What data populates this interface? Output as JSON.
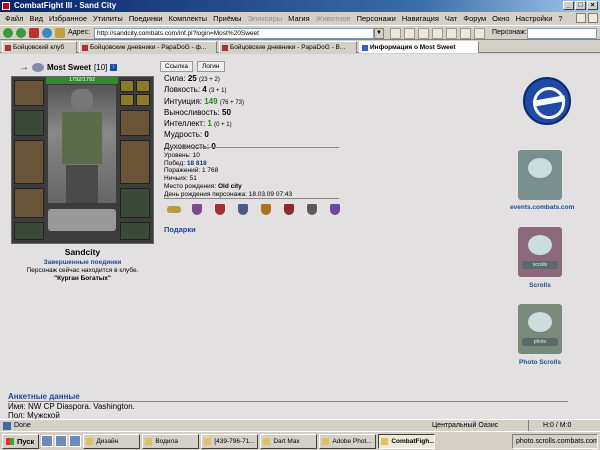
{
  "window": {
    "title": "CombatFight III - Sand City",
    "controls": [
      "_",
      "□",
      "×"
    ]
  },
  "menu": [
    "Файл",
    "Вид",
    "Избранное",
    "Утилиты",
    "Поединки",
    "Комплекты",
    "Приёмы",
    "Эликсиры",
    "Магия",
    "Животное",
    "Персонажи",
    "Навигация",
    "Чат",
    "Форум",
    "Окно",
    "Настройки",
    "?"
  ],
  "menu_disabled": [
    "Эликсиры",
    "Животное"
  ],
  "address": {
    "label": "Адрес:",
    "value": "http://sandcity.combats.com/inf.pl?login=Most%20Sweet",
    "dropdown": "▼"
  },
  "persona_label": "Персонаж:",
  "tabs": [
    {
      "label": "Бойцовский клуб"
    },
    {
      "label": "Бойцовские дневники - PapaDoG - ф..."
    },
    {
      "label": "Бойцовские дневники - PapaDoG - B..."
    },
    {
      "label": "Информация о Most Sweet"
    }
  ],
  "character": {
    "name": "Most Sweet",
    "level": "[10]",
    "info_icon": "i",
    "hp": "1792/1792",
    "display_name": "Sandcity",
    "fights_link": "Завершенные поединки",
    "location_text": "Персонаж сейчас находится в клубе.",
    "club": "\"Курган Богатых\""
  },
  "subtabs": [
    "Ссылка",
    "Логин"
  ],
  "stats": [
    {
      "label": "Сила:",
      "value": "25",
      "sub": "(23 + 2)",
      "green": false
    },
    {
      "label": "Ловкость:",
      "value": "4",
      "sub": "(3 + 1)",
      "green": false
    },
    {
      "label": "Интуиция:",
      "value": "149",
      "sub": "(76 + 73)",
      "green": true
    },
    {
      "label": "Выносливость:",
      "value": "50",
      "sub": "",
      "green": false
    },
    {
      "label": "Интеллект:",
      "value": "1",
      "sub": "(0 + 1)",
      "green": true
    },
    {
      "label": "Мудрость:",
      "value": "0",
      "sub": "",
      "green": false
    },
    {
      "label": "Духовность:",
      "value": "0",
      "sub": "",
      "green": false
    }
  ],
  "info": [
    {
      "label": "Уровень:",
      "value": "10",
      "style": "plain"
    },
    {
      "label": "Побед:",
      "value": "18 818",
      "style": "blue"
    },
    {
      "label": "Поражений:",
      "value": "1 768",
      "style": "plain"
    },
    {
      "label": "Ничьих:",
      "value": "51",
      "style": "plain"
    },
    {
      "label": "Место рождения:",
      "value": "Old city",
      "style": "black"
    },
    {
      "label": "День рождения персонажа:",
      "value": "18.03.09 07:43",
      "style": "plain"
    }
  ],
  "badges": [
    {
      "name": "scroll-badge",
      "color": "#b89a40"
    },
    {
      "name": "shield-badge-1",
      "color": "#7a4a8a"
    },
    {
      "name": "shield-badge-2",
      "color": "#a03030"
    },
    {
      "name": "shield-badge-3",
      "color": "#4a5a8a"
    },
    {
      "name": "shield-badge-4",
      "color": "#b07020"
    },
    {
      "name": "shield-badge-5",
      "color": "#8a2a2a"
    },
    {
      "name": "shield-badge-6",
      "color": "#5a5a5a"
    },
    {
      "name": "shield-badge-7",
      "color": "#6a4aa0"
    }
  ],
  "gifts_label": "Подарки",
  "right": {
    "events_label": "events.combats.com",
    "scrolls_label": "Scrolls",
    "scrolls_caption": "scrolls",
    "photo_label": "Photo Scrolls",
    "photo_caption": "photo"
  },
  "profile": {
    "title": "Анкетные данные",
    "name_line": "Имя: NW CP Diaspora. Vashington.",
    "sex_line": "Пол: Мужской"
  },
  "status": {
    "text": "Done",
    "location": "Центральный Оазис",
    "hm": "H:0 / M:0"
  },
  "taskbar": {
    "start": "Пуск",
    "items": [
      {
        "label": "Дизайн",
        "active": false
      },
      {
        "label": "Водила",
        "active": false
      },
      {
        "label": "[439-796-71...",
        "active": false
      },
      {
        "label": "Dart Max",
        "active": false
      },
      {
        "label": "Adobe Phot...",
        "active": false
      },
      {
        "label": "CombatFigh...",
        "active": true
      }
    ],
    "tray": "photo.scrolls.combats.com"
  },
  "colors": {
    "link": "#1a4a9a",
    "green": "#1b8c1b",
    "titlebar": "#0a246a"
  }
}
